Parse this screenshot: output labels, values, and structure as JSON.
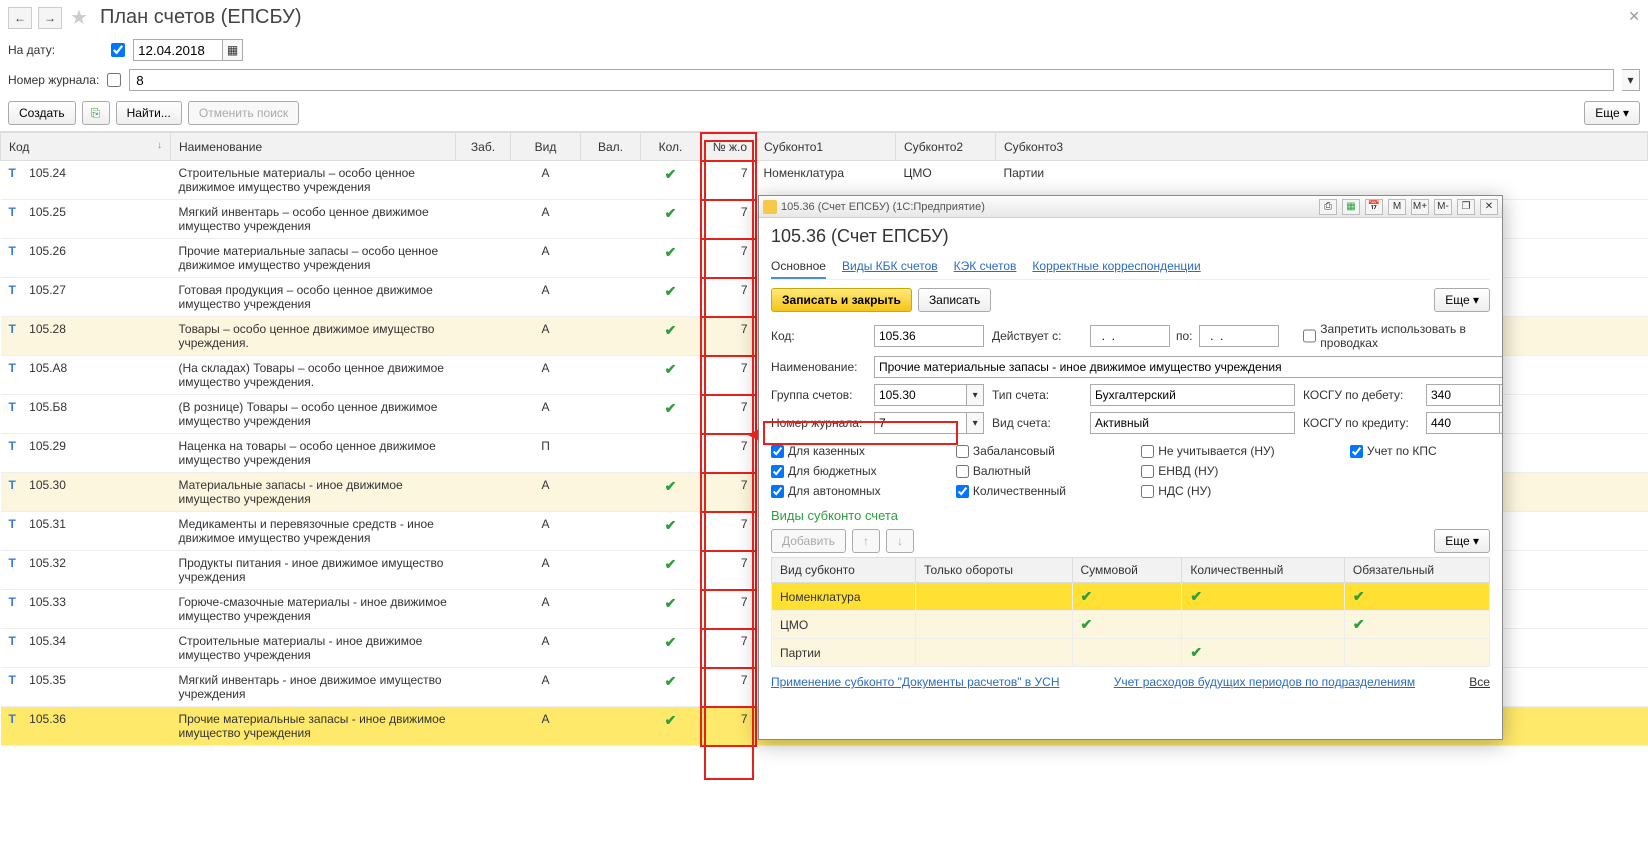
{
  "page": {
    "title": "План счетов (ЕПСБУ)",
    "date_label": "На дату:",
    "date_value": "12.04.2018",
    "journal_label": "Номер журнала:",
    "journal_value": "8"
  },
  "toolbar": {
    "create": "Создать",
    "find": "Найти...",
    "cancel_search": "Отменить поиск",
    "more": "Еще"
  },
  "columns": {
    "code": "Код",
    "name": "Наименование",
    "zab": "Заб.",
    "vid": "Вид",
    "val": "Вал.",
    "kol": "Кол.",
    "num": "№ ж.о",
    "s1": "Субконто1",
    "s2": "Субконто2",
    "s3": "Субконто3"
  },
  "rows": [
    {
      "code": "105.24",
      "name": "Строительные материалы – особо ценное движимое имущество учреждения",
      "vid": "А",
      "kol": true,
      "num": "7",
      "s1": "Номенклатура",
      "s2": "ЦМО",
      "s3": "Партии",
      "shaded": false
    },
    {
      "code": "105.25",
      "name": "Мягкий инвентарь – особо ценное движимое имущество учреждения",
      "vid": "А",
      "kol": true,
      "num": "7",
      "shaded": false
    },
    {
      "code": "105.26",
      "name": "Прочие материальные запасы – особо ценное движимое имущество учреждения",
      "vid": "А",
      "kol": true,
      "num": "7",
      "shaded": false
    },
    {
      "code": "105.27",
      "name": "Готовая продукция – особо ценное движимое имущество учреждения",
      "vid": "А",
      "kol": true,
      "num": "7",
      "shaded": false
    },
    {
      "code": "105.28",
      "name": "Товары –  особо ценное движимое имущество учреждения.",
      "vid": "А",
      "kol": true,
      "num": "7",
      "shaded": true
    },
    {
      "code": "105.А8",
      "name": "(На складах) Товары –  особо ценное движимое имущество учреждения.",
      "vid": "А",
      "kol": true,
      "num": "7",
      "shaded": false
    },
    {
      "code": "105.Б8",
      "name": "(В рознице) Товары –  особо ценное движимое имущество учреждения",
      "vid": "А",
      "kol": true,
      "num": "7",
      "shaded": false
    },
    {
      "code": "105.29",
      "name": "Наценка на товары – особо ценное движимое имущество учреждения",
      "vid": "П",
      "kol": false,
      "num": "7",
      "shaded": false
    },
    {
      "code": "105.30",
      "name": "Материальные запасы - иное движимое имущество учреждения",
      "vid": "А",
      "kol": true,
      "num": "7",
      "shaded": true
    },
    {
      "code": "105.31",
      "name": "Медикаменты и перевязочные средств - иное движимое имущество учреждения",
      "vid": "А",
      "kol": true,
      "num": "7",
      "shaded": false
    },
    {
      "code": "105.32",
      "name": "Продукты питания - иное движимое имущество учреждения",
      "vid": "А",
      "kol": true,
      "num": "7",
      "shaded": false
    },
    {
      "code": "105.33",
      "name": "Горюче-смазочные материалы - иное движимое имущество учреждения",
      "vid": "А",
      "kol": true,
      "num": "7",
      "shaded": false
    },
    {
      "code": "105.34",
      "name": "Строительные материалы - иное движимое имущество учреждения",
      "vid": "А",
      "kol": true,
      "num": "7",
      "shaded": false
    },
    {
      "code": "105.35",
      "name": "Мягкий инвентарь - иное движимое имущество учреждения",
      "vid": "А",
      "kol": true,
      "num": "7",
      "shaded": false
    },
    {
      "code": "105.36",
      "name": "Прочие материальные запасы - иное движимое имущество учреждения",
      "vid": "А",
      "kol": true,
      "num": "7",
      "s1": "Номенклатура",
      "s2": "ЦМО",
      "s3": "Партии",
      "selected": true
    }
  ],
  "popup": {
    "win_title": "105.36 (Счет ЕПСБУ)  (1С:Предприятие)",
    "title": "105.36 (Счет ЕПСБУ)",
    "tabs": {
      "main": "Основное",
      "kbk": "Виды КБК счетов",
      "kek": "КЭК счетов",
      "corr": "Корректные корреспонденции"
    },
    "save_close": "Записать и закрыть",
    "save": "Записать",
    "more": "Еще",
    "fields": {
      "code_l": "Код:",
      "code_v": "105.36",
      "active_from_l": "Действует с:",
      "active_from_v": "  .  .  ",
      "to_l": "по:",
      "to_v": "  .  .  ",
      "forbid_l": "Запретить использовать в проводках",
      "name_l": "Наименование:",
      "name_v": "Прочие материальные запасы - иное движимое имущество учреждения",
      "group_l": "Группа счетов:",
      "group_v": "105.30",
      "acct_type_l": "Тип счета:",
      "acct_type_v": "Бухгалтерский",
      "kosgu_dt_l": "КОСГУ по дебету:",
      "kosgu_dt_v": "340",
      "journal_l": "Номер журнала:",
      "journal_v": "7",
      "vid_l": "Вид счета:",
      "vid_v": "Активный",
      "kosgu_kt_l": "КОСГУ по кредиту:",
      "kosgu_kt_v": "440"
    },
    "checks": {
      "kazen": "Для казенных",
      "zabal": "Забалансовый",
      "nu": "Не учитывается (НУ)",
      "kps": "Учет по КПС",
      "budget": "Для бюджетных",
      "val": "Валютный",
      "envd": "ЕНВД (НУ)",
      "auto": "Для автономных",
      "qty": "Количественный",
      "nds": "НДС (НУ)"
    },
    "sub_section": "Виды субконто счета",
    "add": "Добавить",
    "sub_cols": {
      "kind": "Вид субконто",
      "turn": "Только обороты",
      "sum": "Суммовой",
      "qty": "Количественный",
      "req": "Обязательный"
    },
    "sub_rows": [
      {
        "kind": "Номенклатура",
        "sum": true,
        "qty": true,
        "req": true,
        "sel": true
      },
      {
        "kind": "ЦМО",
        "sum": true,
        "req": true
      },
      {
        "kind": "Партии",
        "qty": true
      }
    ],
    "link1": "Применение субконто \"Документы расчетов\" в УСН",
    "link2": "Учет расходов будущих периодов по подразделениям",
    "all": "Все"
  }
}
